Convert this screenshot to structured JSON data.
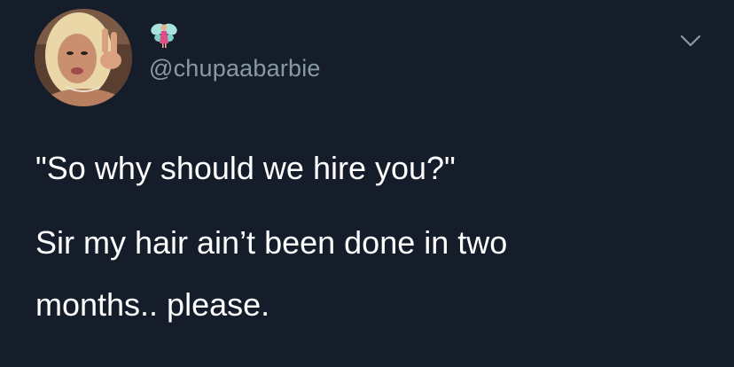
{
  "tweet": {
    "handle": "@chupaabarbie",
    "name_emoji": "fairy-icon",
    "avatar": "profile-photo",
    "menu_icon": "chevron-down-icon",
    "text": {
      "quote": "\"So why should we hire you?\"",
      "reply_line1": "Sir my hair ain’t been done in two",
      "reply_line2": "months.. please."
    }
  },
  "colors": {
    "background": "#151d2b",
    "text_primary": "#ffffff",
    "text_secondary": "#8899a6"
  }
}
